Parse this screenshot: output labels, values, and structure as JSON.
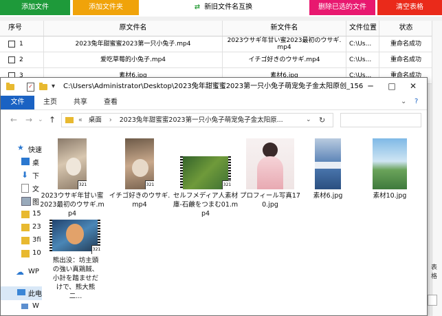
{
  "toolbar": {
    "add_file": "添加文件",
    "add_folder": "添加文件夹",
    "swap": "新旧文件名互换",
    "delete_selected": "删除已选的文件",
    "clear_table": "清空表格"
  },
  "table": {
    "columns": [
      "序号",
      "原文件名",
      "新文件名",
      "文件位置",
      "状态"
    ],
    "rows": [
      {
        "num": "1",
        "orig": "2023兔年甜蜜蜜2023第一只小兔子.mp4",
        "new_line1": "2023ウサギ年甘い蜜2023最初のウサギ.",
        "new_line2": "mp4",
        "loc": "C:\\Us...",
        "status": "重命名成功"
      },
      {
        "num": "2",
        "orig": "爱吃草莓的小兔子.mp4",
        "new_line1": "イチゴ好きのウサギ.mp4",
        "new_line2": "",
        "loc": "C:\\Us...",
        "status": "重命名成功"
      },
      {
        "num": "3",
        "orig": "素材6.jpg",
        "new_line1": "素材6.jpg",
        "new_line2": "",
        "loc": "C:\\Us...",
        "status": "重命名成功"
      }
    ]
  },
  "right_edge_label": "表格",
  "explorer": {
    "title": "C:\\Users\\Administrator\\Desktop\\2023兔年甜蜜蜜2023第一只小兔子萌宠兔子金太阳原创_156",
    "tabs": [
      "文件",
      "主页",
      "共享",
      "查看"
    ],
    "address_root": "桌面",
    "address_folder": "2023兔年甜蜜蜜2023第一只小兔子萌宠兔子金太阳原...",
    "nav_items": [
      "快速",
      "桌",
      "下",
      "文",
      "图",
      "15",
      "23",
      "3fi",
      "10",
      "WP",
      "此电",
      "W"
    ],
    "files": [
      {
        "name": "2023ウサギ年甘い蜜2023最初のウサギ.mp4",
        "kind": "video"
      },
      {
        "name": "イチゴ好きのウサギ.mp4",
        "kind": "video"
      },
      {
        "name": "セルフメディア人素材庫-石鹸をつまむ01.mp4",
        "kind": "video"
      },
      {
        "name": "プロフィール写真170.jpg",
        "kind": "image"
      },
      {
        "name": "素材6.jpg",
        "kind": "image"
      },
      {
        "name": "素材10.jpg",
        "kind": "image"
      },
      {
        "name": "熊出没：坊主頭の強い真鶏賊、小計を踏ませだけで、熊大熊二...",
        "kind": "video"
      }
    ],
    "badge": "321"
  },
  "colors": {
    "add_file": "#1e9a3a",
    "add_folder": "#f0a30a",
    "delete": "#e8186f",
    "clear": "#ea2a1a",
    "ribbon_file": "#1a62c3"
  }
}
